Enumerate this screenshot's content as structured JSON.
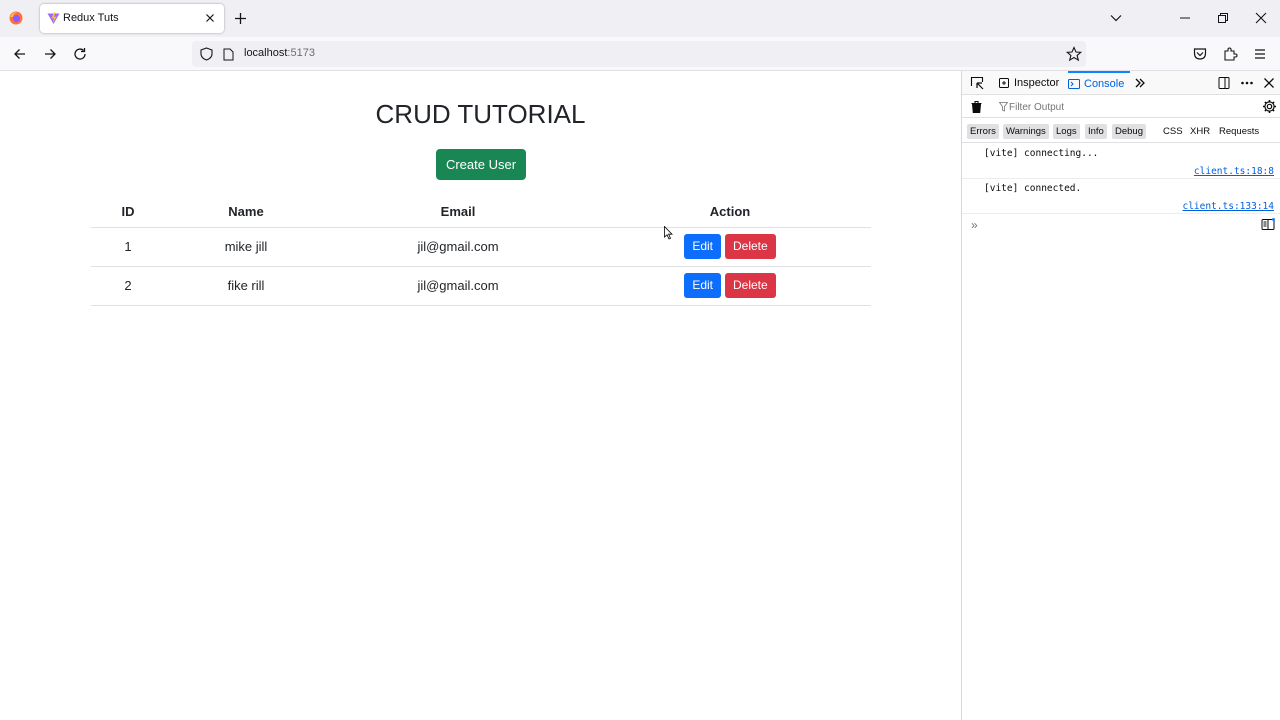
{
  "browser": {
    "tab_title": "Redux Tuts",
    "url_host": "localhost",
    "url_port": ":5173"
  },
  "page": {
    "title": "CRUD TUTORIAL",
    "create_button": "Create User",
    "table": {
      "headers": [
        "ID",
        "Name",
        "Email",
        "Action"
      ],
      "rows": [
        {
          "id": "1",
          "name": "mike jill",
          "email": "jil@gmail.com"
        },
        {
          "id": "2",
          "name": "fike rill",
          "email": "jil@gmail.com"
        }
      ],
      "edit_label": "Edit",
      "delete_label": "Delete"
    },
    "colors": {
      "create": "#198754",
      "edit": "#0d6efd",
      "delete": "#dc3545"
    }
  },
  "devtools": {
    "tabs": {
      "inspector": "Inspector",
      "console": "Console"
    },
    "filter_placeholder": "Filter Output",
    "levels": [
      "Errors",
      "Warnings",
      "Logs",
      "Info",
      "Debug"
    ],
    "net_filters": [
      "CSS",
      "XHR",
      "Requests"
    ],
    "logs": [
      {
        "message": "[vite] connecting...",
        "source": "client.ts:18:8"
      },
      {
        "message": "[vite] connected.",
        "source": "client.ts:133:14"
      }
    ],
    "prompt": "»"
  }
}
